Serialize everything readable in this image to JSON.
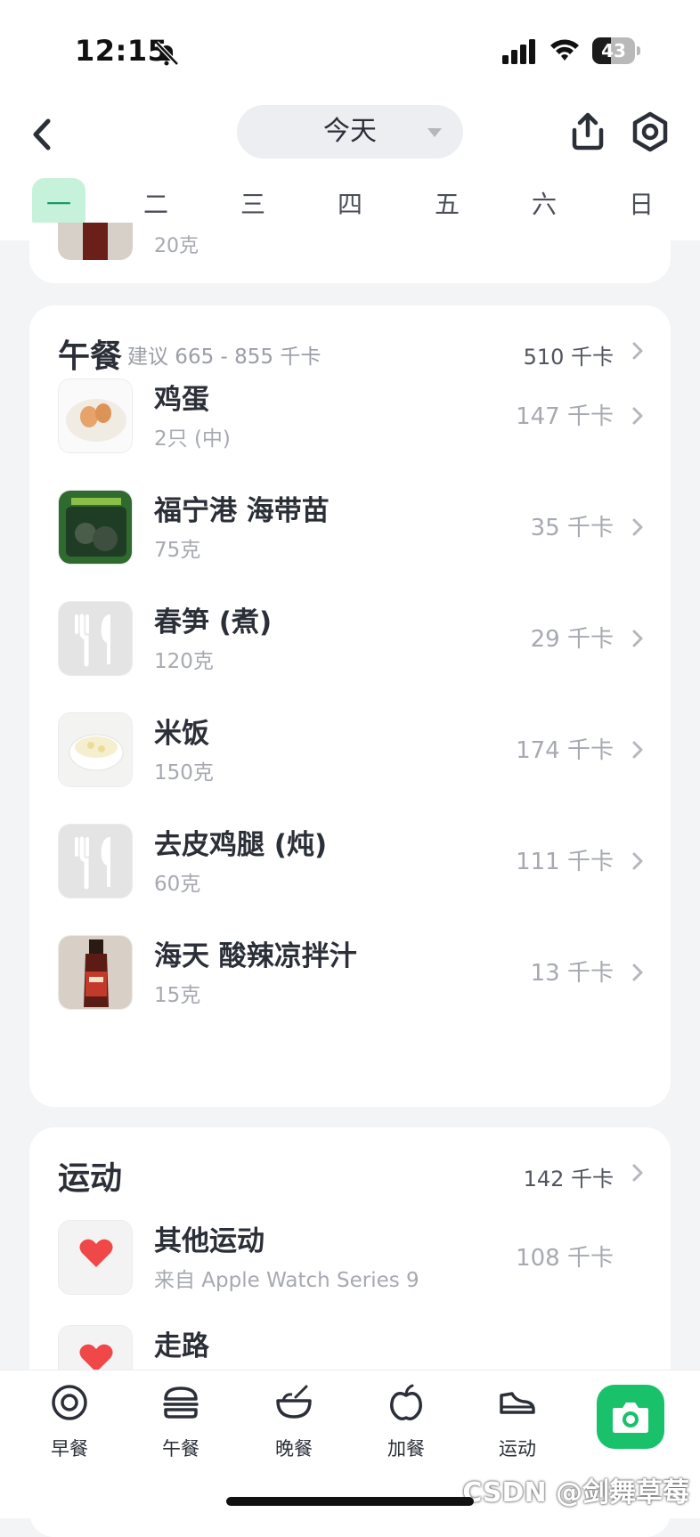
{
  "status": {
    "time": "12:15",
    "battery": "43",
    "battery_level": 0.43
  },
  "header": {
    "date_label": "今天",
    "weekdays": [
      "一",
      "二",
      "三",
      "四",
      "五",
      "六",
      "日"
    ],
    "active_weekday": 0
  },
  "previous_item": {
    "qty": "20克"
  },
  "lunch": {
    "title": "午餐",
    "hint": "建议 665 - 855 千卡",
    "total": "510 千卡",
    "items": [
      {
        "name": "鸡蛋",
        "qty": "2只 (中)",
        "kcal": "147 千卡",
        "thumb": "eggs-photo"
      },
      {
        "name": "福宁港 海带苗",
        "qty": "75克",
        "kcal": "35 千卡",
        "thumb": "seaweed-package-photo"
      },
      {
        "name": "春笋 (煮)",
        "qty": "120克",
        "kcal": "29 千卡",
        "thumb": "utensils-placeholder"
      },
      {
        "name": "米饭",
        "qty": "150克",
        "kcal": "174 千卡",
        "thumb": "rice-bowl-photo"
      },
      {
        "name": "去皮鸡腿 (炖)",
        "qty": "60克",
        "kcal": "111 千卡",
        "thumb": "utensils-placeholder"
      },
      {
        "name": "海天 酸辣凉拌汁",
        "qty": "15克",
        "kcal": "13 千卡",
        "thumb": "sauce-bottle-photo"
      }
    ]
  },
  "sport": {
    "title": "运动",
    "total": "142 千卡",
    "items": [
      {
        "name": "其他运动",
        "qty": "来自 Apple Watch Series 9",
        "kcal": "108 千卡",
        "thumb": "heart-icon"
      },
      {
        "name": "走路",
        "thumb": "heart-icon"
      }
    ]
  },
  "tabbar": {
    "tabs": [
      {
        "label": "早餐",
        "icon": "breakfast-icon"
      },
      {
        "label": "午餐",
        "icon": "burger-icon"
      },
      {
        "label": "晚餐",
        "icon": "bowl-icon"
      },
      {
        "label": "加餐",
        "icon": "apple-icon"
      },
      {
        "label": "运动",
        "icon": "sneaker-icon"
      }
    ],
    "camera_icon": "camera-icon"
  },
  "watermark": "CSDN @剑舞草莓",
  "colors": {
    "accent": "#19c16b",
    "active_day_bg": "#c6f2dc",
    "heart": "#f04848"
  }
}
